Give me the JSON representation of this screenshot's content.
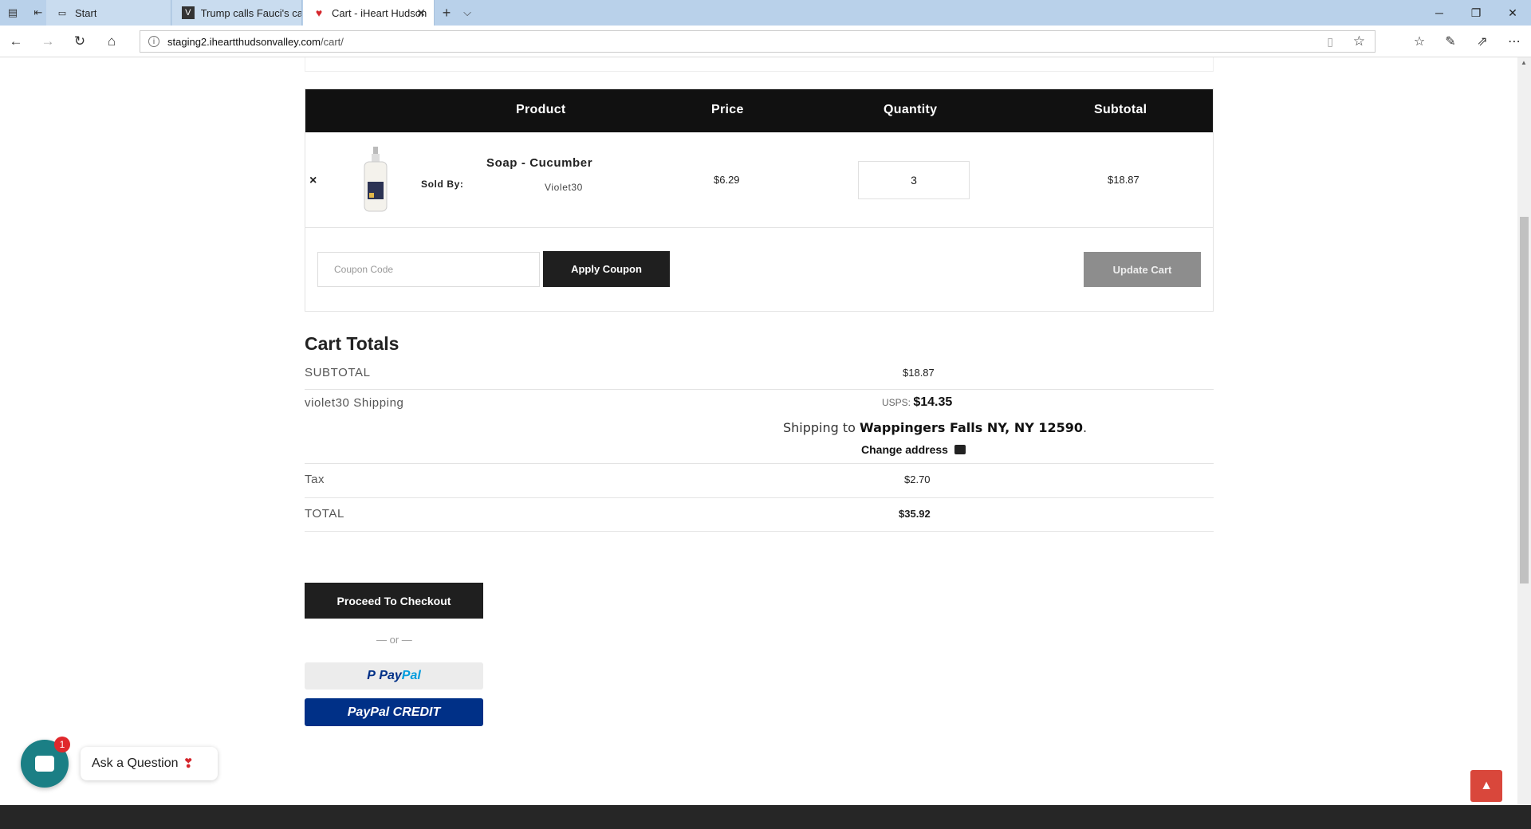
{
  "browser": {
    "tabs": [
      {
        "title": "Start",
        "favicon": "start-page-icon"
      },
      {
        "title": "Trump calls Fauci's caution c",
        "favicon": "news-site-icon"
      },
      {
        "title": "Cart - iHeart Hudson Va",
        "favicon": "iheart-heart-icon",
        "active": true
      }
    ],
    "new_tab_glyph": "+",
    "tab_list_glyph": "⌵",
    "url_host": "staging2.iheartthudsonvalley.com",
    "url_path": "/cart/"
  },
  "cart": {
    "headers": {
      "product": "Product",
      "price": "Price",
      "quantity": "Quantity",
      "subtotal": "Subtotal"
    },
    "items": [
      {
        "remove_glyph": "×",
        "sold_by_label": "Sold By:",
        "name": "Soap - Cucumber",
        "vendor": "Violet30",
        "price": "$6.29",
        "quantity": "3",
        "subtotal": "$18.87"
      }
    ],
    "coupon_placeholder": "Coupon Code",
    "apply_coupon_label": "Apply Coupon",
    "update_cart_label": "Update Cart"
  },
  "totals": {
    "title": "Cart Totals",
    "subtotal_label": "SUBTOTAL",
    "subtotal_value": "$18.87",
    "shipping_label": "violet30 Shipping",
    "shipping_method": "USPS:",
    "shipping_price": "$14.35",
    "shipping_to_prefix": "Shipping to",
    "shipping_to_place": "Wappingers Falls NY, NY 12590",
    "shipping_to_suffix": ".",
    "change_address_label": "Change address",
    "tax_label": "Tax",
    "tax_value": "$2.70",
    "total_label": "TOTAL",
    "total_value": "$35.92"
  },
  "checkout": {
    "proceed_label": "Proceed To Checkout",
    "or_text": "— or —",
    "paypal_prefix": "P",
    "paypal_pay": "Pay",
    "paypal_pal": "Pal",
    "paypal_credit_label": "PayPal CREDIT"
  },
  "chat": {
    "badge_count": "1",
    "ask_label": "Ask a Question",
    "heart_glyph": "❣"
  },
  "colors": {
    "table_header_bg": "#111111",
    "primary_button": "#1f1f1f",
    "disabled_button": "#8d8d8d",
    "paypal_blue": "#003087",
    "chat_teal": "#1b7f85",
    "back_to_top": "#d9473b"
  }
}
